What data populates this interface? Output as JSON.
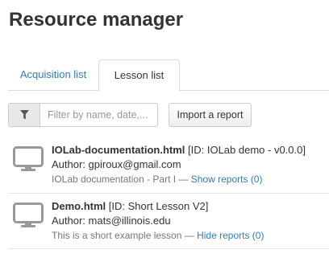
{
  "page": {
    "title": "Resource manager"
  },
  "tabs": [
    {
      "label": "Acquisition list",
      "active": false
    },
    {
      "label": "Lesson list",
      "active": true
    }
  ],
  "toolbar": {
    "filter_icon": "filter-icon",
    "filter_placeholder": "Filter by name, date,...",
    "filter_value": "",
    "import_label": "Import a report"
  },
  "lessons": [
    {
      "icon": "monitor-icon",
      "filename": "IOLab-documentation.html",
      "id_text": "[ID: IOLab demo - v0.0.0]",
      "author": "Author: gpiroux@gmail.com",
      "description": "IOLab documentation - Part I",
      "separator": "—",
      "report_link": "Show reports (0)"
    },
    {
      "icon": "monitor-icon",
      "filename": "Demo.html",
      "id_text": "[ID: Short Lesson V2]",
      "author": "Author: mats@illinois.edu",
      "description": "This is a short example lesson",
      "separator": "—",
      "report_link": "Hide reports (0)"
    }
  ],
  "colors": {
    "link": "#337ab7",
    "text": "#333333",
    "muted": "#777777",
    "icon": "#999999",
    "border": "#dddddd"
  }
}
